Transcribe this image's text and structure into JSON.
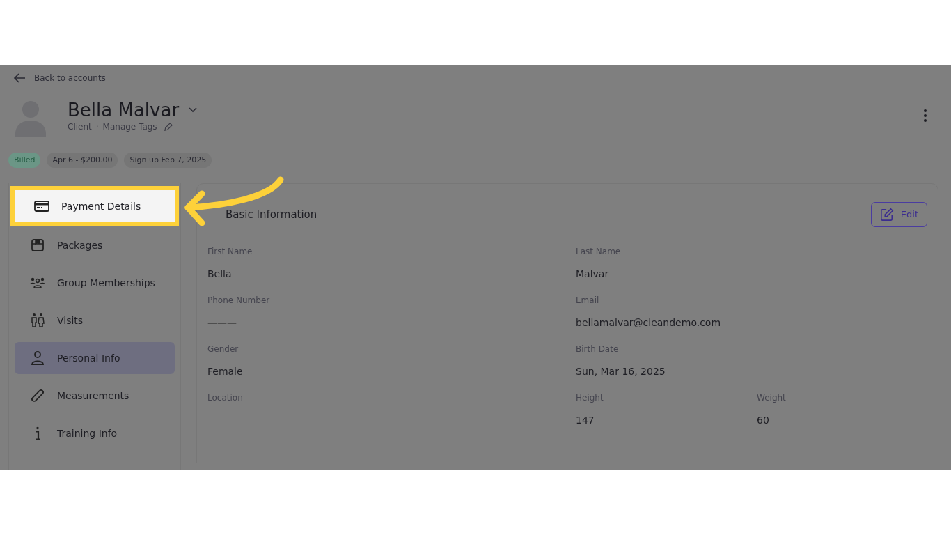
{
  "back_link": "Back to accounts",
  "profile": {
    "name": "Bella Malvar",
    "role": "Client",
    "separator": "·",
    "tags_link": "Manage Tags"
  },
  "chips": [
    {
      "label": "Billed",
      "kind": "status"
    },
    {
      "label": "Apr 6 - $200.00",
      "kind": "plain"
    },
    {
      "label": "Sign up Feb 7, 2025",
      "kind": "plain"
    }
  ],
  "sidebar": {
    "items": [
      {
        "label": "Payment Details",
        "selected": false,
        "highlighted": true
      },
      {
        "label": "Packages",
        "selected": false,
        "highlighted": false
      },
      {
        "label": "Group Memberships",
        "selected": false,
        "highlighted": false
      },
      {
        "label": "Visits",
        "selected": false,
        "highlighted": false
      },
      {
        "label": "Personal Info",
        "selected": true,
        "highlighted": false
      },
      {
        "label": "Measurements",
        "selected": false,
        "highlighted": false
      },
      {
        "label": "Training Info",
        "selected": false,
        "highlighted": false
      }
    ]
  },
  "card": {
    "title": "Basic Information",
    "edit_button": "Edit",
    "rows": [
      [
        {
          "label": "First Name",
          "value": "Bella",
          "empty": false
        },
        {
          "label": "Last Name",
          "value": "Malvar",
          "empty": false
        }
      ],
      [
        {
          "label": "Phone Number",
          "value": "———",
          "empty": true
        },
        {
          "label": "Email",
          "value": "bellamalvar@cleandemo.com",
          "empty": false
        }
      ],
      [
        {
          "label": "Gender",
          "value": "Female",
          "empty": false
        },
        {
          "label": "Birth Date",
          "value": "Sun, Mar 16, 2025",
          "empty": false
        }
      ],
      [
        {
          "label": "Location",
          "value": "———",
          "empty": true
        },
        {
          "label": "Height",
          "value": "147",
          "empty": false
        },
        {
          "label": "Weight",
          "value": "60",
          "empty": false
        }
      ]
    ]
  }
}
